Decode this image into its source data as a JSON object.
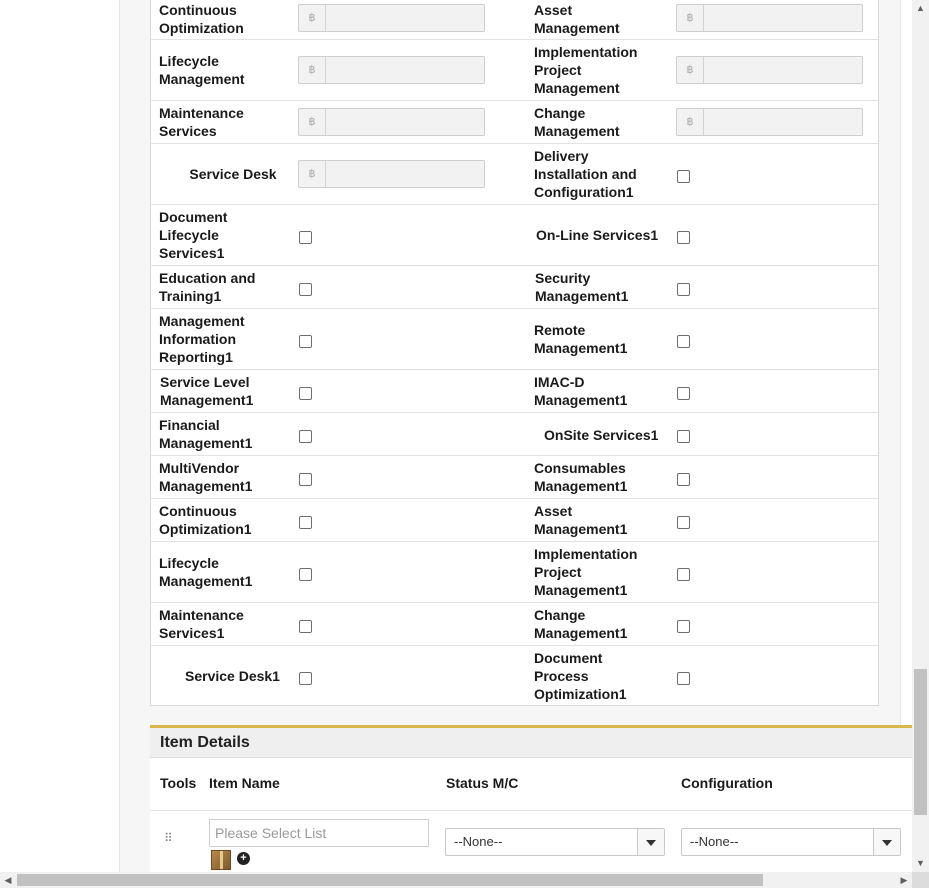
{
  "currency_symbol": "฿",
  "services": {
    "money_rows": [
      {
        "left": "Continuous Optimization",
        "right": "Asset Management"
      },
      {
        "left": "Lifecycle Management",
        "right": "Implementation Project Management"
      },
      {
        "left": "Maintenance Services",
        "right": "Change Management"
      },
      {
        "left": "Service Desk",
        "right": "Delivery Installation and Configuration1"
      }
    ],
    "checkbox_rows": [
      {
        "left": "Document Lifecycle Services1",
        "right": "On-Line Services1"
      },
      {
        "left": "Education and Training1",
        "right": "Security Management1"
      },
      {
        "left": "Management Information Reporting1",
        "right": "Remote Management1"
      },
      {
        "left": "Service Level Management1",
        "right": "IMAC-D Management1"
      },
      {
        "left": "Financial Management1",
        "right": "OnSite Services1"
      },
      {
        "left": "MultiVendor Management1",
        "right": "Consumables Management1"
      },
      {
        "left": "Continuous Optimization1",
        "right": "Asset Management1"
      },
      {
        "left": "Lifecycle Management1",
        "right": "Implementation Project Management1"
      },
      {
        "left": "Maintenance Services1",
        "right": "Change Management1"
      },
      {
        "left": "Service Desk1",
        "right": "Document Process Optimization1"
      }
    ]
  },
  "item_details": {
    "title": "Item Details",
    "columns": {
      "tools": "Tools",
      "item_name": "Item Name",
      "status": "Status M/C",
      "configuration": "Configuration"
    },
    "item_name_placeholder": "Please Select List",
    "status_value": "--None--",
    "configuration_value": "--None--"
  },
  "accent_color": "#d8b84a"
}
